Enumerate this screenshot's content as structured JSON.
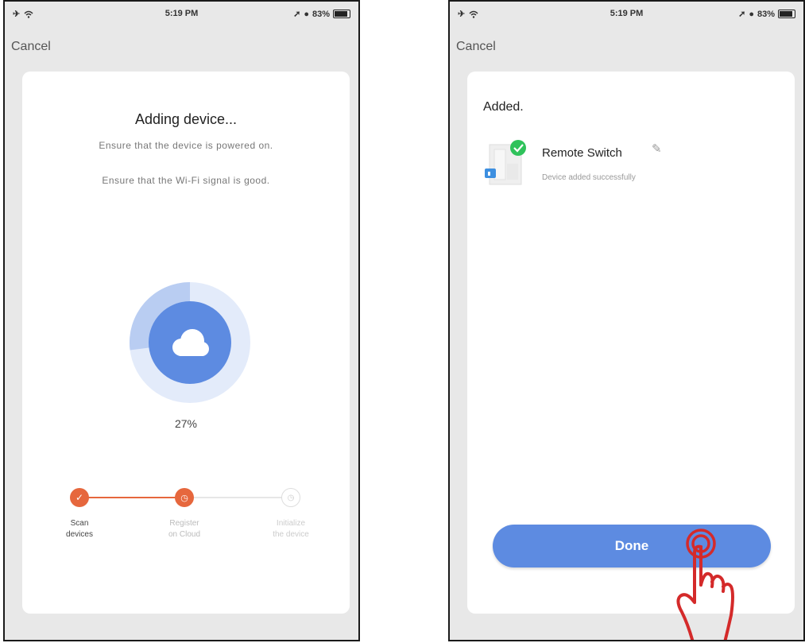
{
  "left_screen": {
    "status": {
      "time": "5:19 PM",
      "battery": "83%"
    },
    "cancel_label": "Cancel",
    "title": "Adding device...",
    "hints": [
      "Ensure that the device is powered on.",
      "Ensure that the Wi-Fi signal is good."
    ],
    "progress_percent": 27,
    "progress_label": "27%",
    "steps": [
      {
        "label_line1": "Scan",
        "label_line2": "devices",
        "state": "done"
      },
      {
        "label_line1": "Register",
        "label_line2": "on Cloud",
        "state": "active"
      },
      {
        "label_line1": "Initialize",
        "label_line2": "the device",
        "state": "pending"
      }
    ]
  },
  "right_screen": {
    "status": {
      "time": "5:19 PM",
      "battery": "83%"
    },
    "cancel_label": "Cancel",
    "added_title": "Added.",
    "device": {
      "name": "Remote Switch",
      "status": "Device added successfully"
    },
    "done_label": "Done"
  },
  "colors": {
    "accent_blue": "#5d8be1",
    "accent_orange": "#e6673d",
    "success_green": "#2fc25b",
    "hand_red": "#d42a2a"
  },
  "icons": [
    "wifi-icon",
    "location-arrow-icon",
    "battery-icon",
    "cloud-icon",
    "check-icon",
    "clock-icon",
    "edit-pencil-icon",
    "pointing-hand-icon"
  ]
}
